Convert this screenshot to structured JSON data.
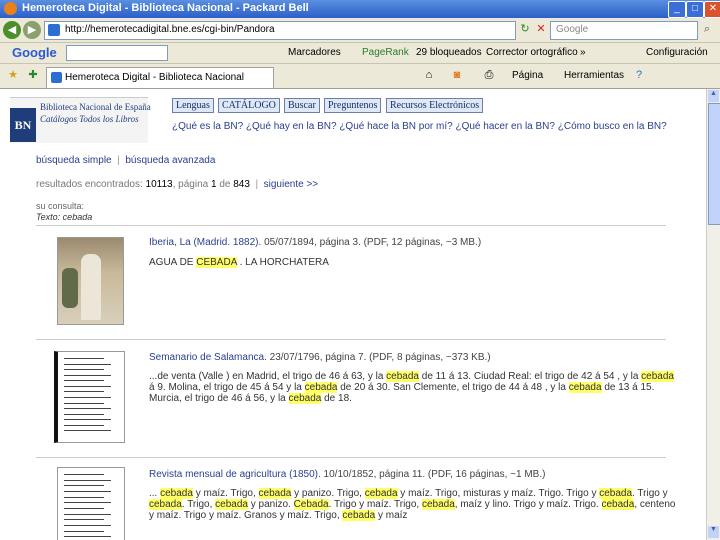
{
  "browser": {
    "window_title": "Hemeroteca Digital - Biblioteca Nacional - Packard Bell",
    "url": "http://hemerotecadigital.bne.es/cgi-bin/Pandora",
    "search_placeholder": "Google",
    "tab_label": "Hemeroteca Digital - Biblioteca Nacional"
  },
  "toolbar": {
    "google_label": "Google",
    "items": [
      "Marcadores",
      "PageRank",
      "29 bloqueados",
      "Corrector ortográfico",
      "Configuración"
    ],
    "chevron": "»"
  },
  "command_bar": {
    "items": [
      "Página",
      "Herramientas"
    ]
  },
  "site": {
    "logo": {
      "initials": "BN",
      "name": "Biblioteca Nacional de España",
      "motto": "Catálogos Todos los Libros"
    },
    "menu": [
      "Lenguas",
      "CATÁLOGO",
      "Buscar",
      "Preguntenos",
      "Recursos Electrónicos"
    ],
    "questions": "¿Qué es la BN?   ¿Qué hay en la BN?   ¿Qué hace la BN por mí?   ¿Qué hacer en la BN?   ¿Cómo busco en la BN?",
    "search_simple": "búsqueda simple",
    "search_advanced": "búsqueda avanzada",
    "separator": "|",
    "results_prefix": "resultados encontrados:",
    "results_count": "10113",
    "page_label": "página",
    "page_current": "1",
    "page_of": "de",
    "page_total": "843",
    "next_label": "siguiente >>",
    "query_label": "su consulta:",
    "query_value": "Texto: cebada"
  },
  "results": [
    {
      "title": "Iberia, La (Madrid. 1882).",
      "meta": "05/07/1894, página 3. (PDF, 12 páginas, ~3 MB.)",
      "snippet_parts": [
        {
          "t": "AGUA DE ",
          "h": false
        },
        {
          "t": "CEBADA",
          "h": true
        },
        {
          "t": " . LA HORCHATERA",
          "h": false
        }
      ]
    },
    {
      "title": "Semanario de Salamanca.",
      "meta": "23/07/1796, página 7. (PDF, 8 páginas, ~373 KB.)",
      "snippet_parts": [
        {
          "t": "...de venta (Valle ) en Madrid, el trigo de 46 á 63, y la ",
          "h": false
        },
        {
          "t": "cebada",
          "h": true
        },
        {
          "t": " de 11 á 13. Ciudad Real: el trigo de 42 á 54 , y la ",
          "h": false
        },
        {
          "t": "cebada",
          "h": true
        },
        {
          "t": " á 9. Molina, el trigo de 45 á 54 y la ",
          "h": false
        },
        {
          "t": "cebada",
          "h": true
        },
        {
          "t": " de 20 á 30. San Clemente, el trigo de 44 á 48 , y la ",
          "h": false
        },
        {
          "t": "cebada",
          "h": true
        },
        {
          "t": " de 13 á 15. Murcia, el trigo de 46 á 56, y la ",
          "h": false
        },
        {
          "t": "cebada",
          "h": true
        },
        {
          "t": " de 18.",
          "h": false
        }
      ]
    },
    {
      "title": "Revista mensual de agricultura (1850).",
      "meta": "10/10/1852, página 11. (PDF, 16 páginas, ~1 MB.)",
      "snippet_parts": [
        {
          "t": "... ",
          "h": false
        },
        {
          "t": "cebada",
          "h": true
        },
        {
          "t": " y maíz. Trigo, ",
          "h": false
        },
        {
          "t": "cebada",
          "h": true
        },
        {
          "t": " y panizo. Trigo, ",
          "h": false
        },
        {
          "t": "cebada",
          "h": true
        },
        {
          "t": " y maíz. Trigo, misturas y maíz. Trigo. Trigo y ",
          "h": false
        },
        {
          "t": "cebada",
          "h": true
        },
        {
          "t": ". Trigo y ",
          "h": false
        },
        {
          "t": "cebada",
          "h": true
        },
        {
          "t": ". Trigo, ",
          "h": false
        },
        {
          "t": "cebada",
          "h": true
        },
        {
          "t": " y panizo. ",
          "h": false
        },
        {
          "t": "Cebada",
          "h": true
        },
        {
          "t": ". Trigo y maíz. Trigo, ",
          "h": false
        },
        {
          "t": "cebada",
          "h": true
        },
        {
          "t": ", maíz y lino. Trigo y maíz. Trigo. ",
          "h": false
        },
        {
          "t": "cebada",
          "h": true
        },
        {
          "t": ", centeno y maíz. Trigo y maíz. Granos y maíz. Trigo, ",
          "h": false
        },
        {
          "t": "cebada",
          "h": true
        },
        {
          "t": " y maíz",
          "h": false
        }
      ]
    }
  ]
}
